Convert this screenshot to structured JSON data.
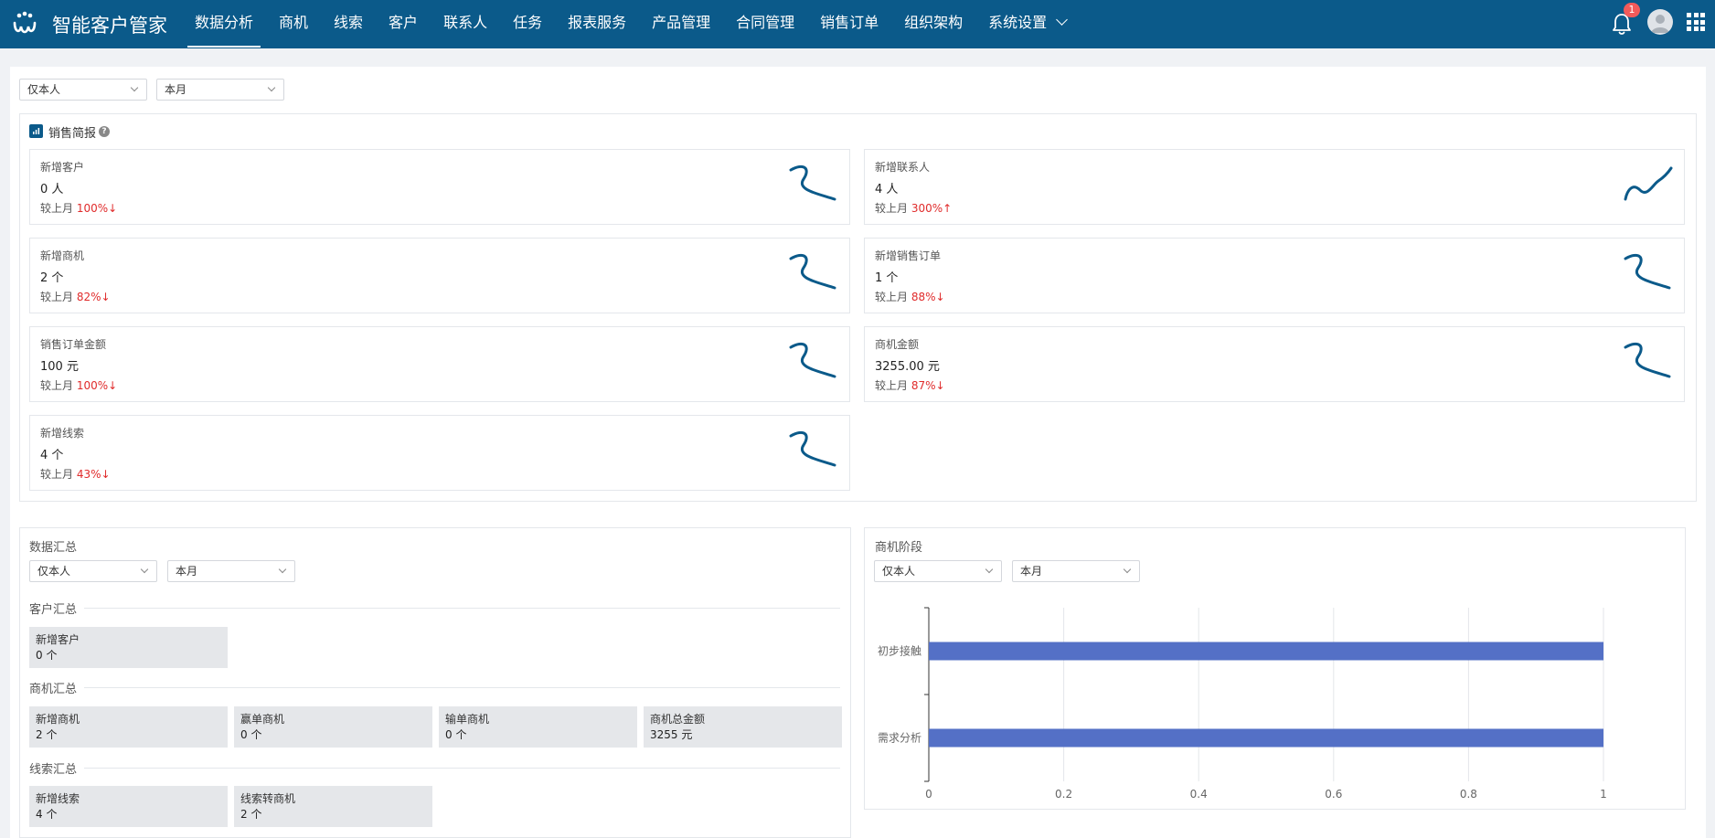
{
  "app": {
    "title": "智能客户管家"
  },
  "nav": {
    "items": [
      {
        "label": "数据分析",
        "active": true
      },
      {
        "label": "商机"
      },
      {
        "label": "线索"
      },
      {
        "label": "客户"
      },
      {
        "label": "联系人"
      },
      {
        "label": "任务"
      },
      {
        "label": "报表服务"
      },
      {
        "label": "产品管理"
      },
      {
        "label": "合同管理"
      },
      {
        "label": "销售订单"
      },
      {
        "label": "组织架构"
      },
      {
        "label": "系统设置"
      }
    ],
    "notification_count": "1",
    "icons": [
      "logo-icon",
      "bell-icon",
      "avatar",
      "apps-grid-icon"
    ]
  },
  "filters": {
    "scope": "仅本人",
    "period": "本月"
  },
  "sales_report": {
    "title": "销售简报",
    "compare_prefix": "较上月",
    "cards": [
      {
        "label": "新增客户",
        "value": "0 人",
        "change": "100%↓"
      },
      {
        "label": "新增联系人",
        "value": "4 人",
        "change": "300%↑"
      },
      {
        "label": "新增商机",
        "value": "2 个",
        "change": "82%↓"
      },
      {
        "label": "新增销售订单",
        "value": "1 个",
        "change": "88%↓"
      },
      {
        "label": "销售订单金额",
        "value": "100 元",
        "change": "100%↓"
      },
      {
        "label": "商机金额",
        "value": "3255.00 元",
        "change": "87%↓"
      },
      {
        "label": "新增线索",
        "value": "4 个",
        "change": "43%↓"
      }
    ],
    "trend_color_up": "#e02b2b",
    "trend_color_down": "#e02b2b"
  },
  "summary": {
    "title": "数据汇总",
    "scope": "仅本人",
    "period": "本月",
    "customer": {
      "title": "客户汇总",
      "items": [
        {
          "label": "新增客户",
          "value": "0 个"
        }
      ]
    },
    "opportunity": {
      "title": "商机汇总",
      "items": [
        {
          "label": "新增商机",
          "value": "2 个"
        },
        {
          "label": "赢单商机",
          "value": "0 个"
        },
        {
          "label": "输单商机",
          "value": "0 个"
        },
        {
          "label": "商机总金额",
          "value": "3255 元"
        }
      ]
    },
    "lead": {
      "title": "线索汇总",
      "items": [
        {
          "label": "新增线索",
          "value": "4 个"
        },
        {
          "label": "线索转商机",
          "value": "2 个"
        }
      ]
    }
  },
  "stage": {
    "title": "商机阶段",
    "scope": "仅本人",
    "period": "本月"
  },
  "chart_data": {
    "type": "bar",
    "orientation": "horizontal",
    "categories": [
      "初步接触",
      "需求分析"
    ],
    "values": [
      1,
      1
    ],
    "xlim": [
      0,
      1
    ],
    "xticks": [
      "0",
      "0.2",
      "0.4",
      "0.6",
      "0.8",
      "1"
    ],
    "grid": true,
    "color": "#5470c6"
  },
  "colors": {
    "brand": "#0b5a8a",
    "bar": "#5470c6",
    "decline": "#e02b2b"
  }
}
